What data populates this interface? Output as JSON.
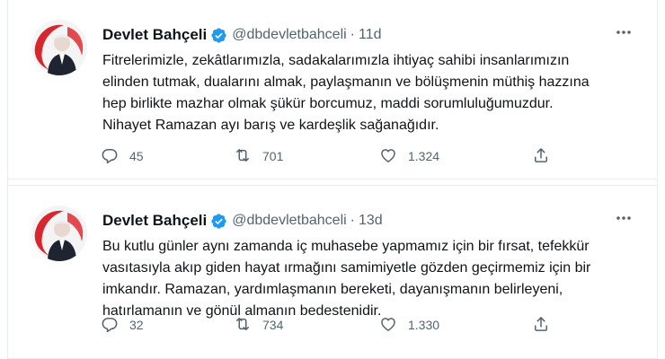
{
  "tweets": [
    {
      "author_name": "Devlet Bahçeli",
      "handle": "@dbdevletbahceli",
      "separator": "·",
      "time": "11d",
      "lines": [
        "Fitrelerimizle, zekâtlarımızla, sadakalarımızla ihtiyaç sahibi insanlarımızın",
        "elinden tutmak, dualarını almak, paylaşmanın ve bölüşmenin müthiş hazzına",
        "hep birlikte mazhar olmak şükür borcumuz, maddi sorumluluğumuzdur.",
        "Nihayet Ramazan ayı barış ve kardeşlik sağanağıdır."
      ],
      "replies": "45",
      "retweets": "701",
      "likes": "1.324"
    },
    {
      "author_name": "Devlet Bahçeli",
      "handle": "@dbdevletbahceli",
      "separator": "·",
      "time": "13d",
      "lines": [
        "Bu kutlu günler aynı zamanda iç muhasebe yapmamız için bir fırsat, tefekkür",
        "vasıtasıyla akıp giden hayat ırmağını samimiyetle gözden geçirmemiz için bir",
        "imkandır. Ramazan, yardımlaşmanın bereketi, dayanışmanın belirleyeni,",
        "hatırlamanın ve gönül almanın bedestenidir."
      ],
      "replies": "32",
      "retweets": "734",
      "likes": "1.330"
    }
  ],
  "icons": {
    "verified": "verified-badge-icon",
    "more": "more-options-icon",
    "reply": "reply-icon",
    "retweet": "retweet-icon",
    "like": "like-icon",
    "share": "share-icon"
  },
  "colors": {
    "accent": "#1d9bf0",
    "muted": "#536471",
    "text": "#0f1419",
    "divider": "#e6ecf0",
    "avatar_red": "#d7262d"
  }
}
